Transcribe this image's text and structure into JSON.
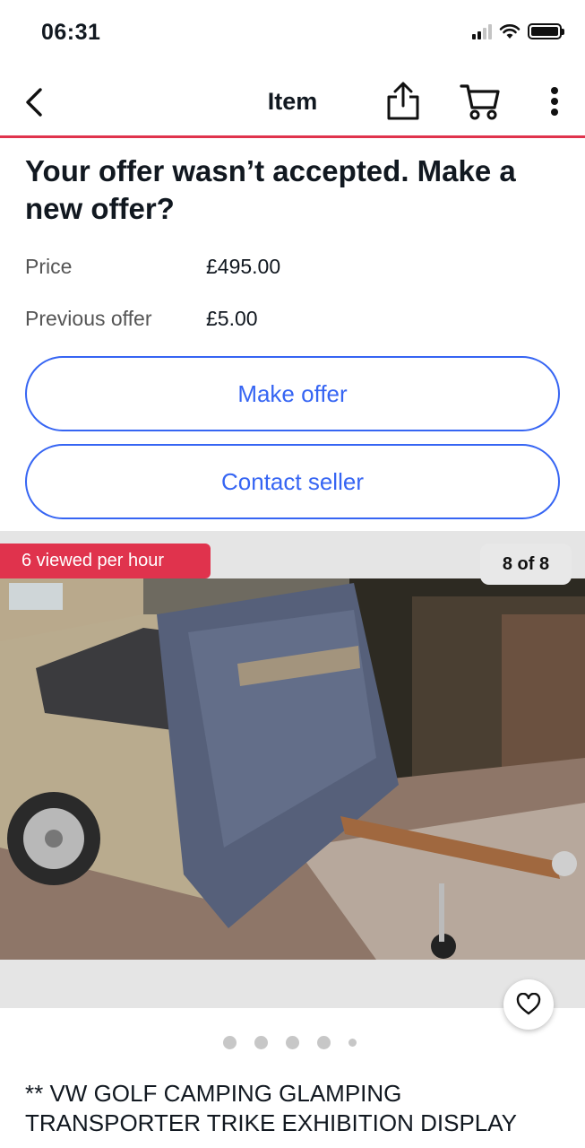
{
  "status_bar": {
    "time": "06:31",
    "icons": [
      "signal-icon",
      "wifi-icon",
      "battery-icon"
    ]
  },
  "nav": {
    "title": "Item",
    "icons": [
      "back-chevron-icon",
      "share-icon",
      "cart-icon",
      "more-vertical-icon"
    ]
  },
  "offer": {
    "heading": "Your offer wasn’t accepted. Make a new offer?",
    "price_label": "Price",
    "price_value": "£495.00",
    "previous_label": "Previous offer",
    "previous_value": "£5.00",
    "make_offer_label": "Make offer",
    "contact_seller_label": "Contact seller"
  },
  "gallery": {
    "views_badge": "6 viewed per hour",
    "counter": "8 of 8",
    "dots_count": 5,
    "favorite_icon": "heart-outline-icon"
  },
  "listing": {
    "title": "** VW GOLF CAMPING GLAMPING TRANSPORTER TRIKE EXHIBITION DISPLAY"
  },
  "colors": {
    "accent_blue": "#3665f3",
    "brand_red": "#e0334d",
    "text": "#111820"
  }
}
